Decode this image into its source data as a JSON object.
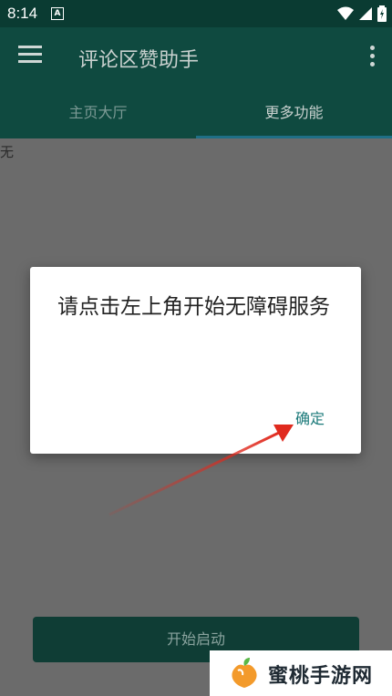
{
  "status_bar": {
    "time": "8:14",
    "notification_icon": "A"
  },
  "app_bar": {
    "title": "评论区赞助手"
  },
  "tabs": [
    {
      "label": "主页大厅"
    },
    {
      "label": "更多功能"
    }
  ],
  "content": {
    "empty_text": "无",
    "start_button_label": "开始启动"
  },
  "dialog": {
    "message": "请点击左上角开始无障碍服务",
    "ok_label": "确定"
  },
  "watermark": {
    "text": "蜜桃手游网"
  },
  "colors": {
    "toolbar": "#0f4a40",
    "status_bar": "#0a3b32",
    "accent": "#1b7a7a",
    "overlay": "#6b6b6b",
    "arrow": "#e02a1e"
  }
}
